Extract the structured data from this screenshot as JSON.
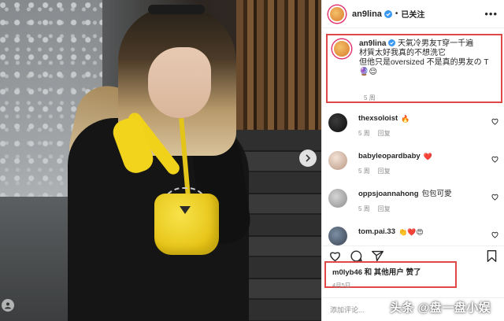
{
  "post": {
    "username": "an9lina",
    "follow_state": "已关注",
    "dot": "•",
    "more_icon": "ellipsis-icon",
    "caption_line1": "天氣冷男友T穿一千遍",
    "caption_line2": "材質太好我真的不想洗它",
    "caption_line3": "但他只是oversized 不是真的男友の T",
    "caption_emoji": "🔮😌",
    "caption_time": "5 周"
  },
  "comments": [
    {
      "user": "thexsoloist",
      "text": "🔥",
      "time": "5 周",
      "reply": "回复"
    },
    {
      "user": "babyleopardbaby",
      "text": "❤️",
      "time": "5 周",
      "reply": "回复"
    },
    {
      "user": "oppsjoannahong",
      "text": "包包可愛",
      "time": "5 周",
      "reply": "回复"
    },
    {
      "user": "tom.pai.33",
      "text": "👏❤️😍"
    }
  ],
  "actions": {
    "like_icon": "heart-icon",
    "comment_icon": "comment-icon",
    "share_icon": "share-icon",
    "save_icon": "bookmark-icon"
  },
  "likes": {
    "user": "m0lyb46",
    "suffix": "和 其他用户 赞了",
    "date": "4月5日"
  },
  "add_comment_placeholder": "添加评论...",
  "watermark": "头条 @盘一盘小娱",
  "colors": {
    "highlight_border": "#e04848",
    "verified_blue": "#3897f0",
    "heart_red": "#ed4956"
  }
}
